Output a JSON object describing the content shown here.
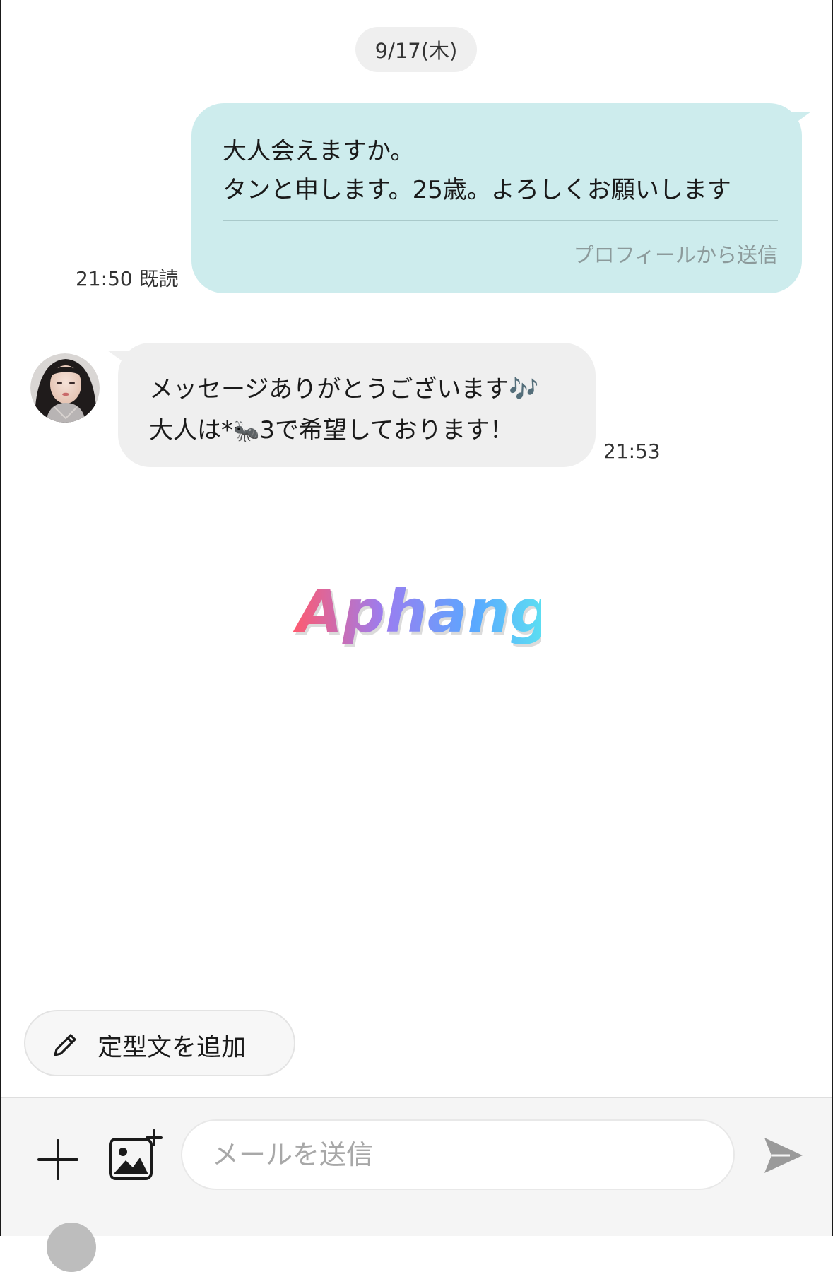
{
  "chat": {
    "date": "9/17(木)",
    "sent_message": {
      "line1": "大人会えますか。",
      "line2": "タンと申します。25歳。よろしくお願いします",
      "source": "プロフィールから送信",
      "time": "21:50",
      "read_status": "既読"
    },
    "received_message": {
      "line1_text": "メッセージありがとうございます",
      "line1_emoji": "🎶",
      "line2_prefix": "大人は*",
      "line2_emoji": "🐜",
      "line2_suffix": "3で希望しております！",
      "time": "21:53"
    }
  },
  "watermark": {
    "text": "Aphang"
  },
  "template_button": {
    "label": "定型文を追加"
  },
  "input_bar": {
    "placeholder": "メールを送信"
  },
  "colors": {
    "sent_bubble": "#cdeced",
    "received_bubble": "#efefef",
    "date_chip": "#efefef",
    "note_accent": "#ec3f7c"
  }
}
